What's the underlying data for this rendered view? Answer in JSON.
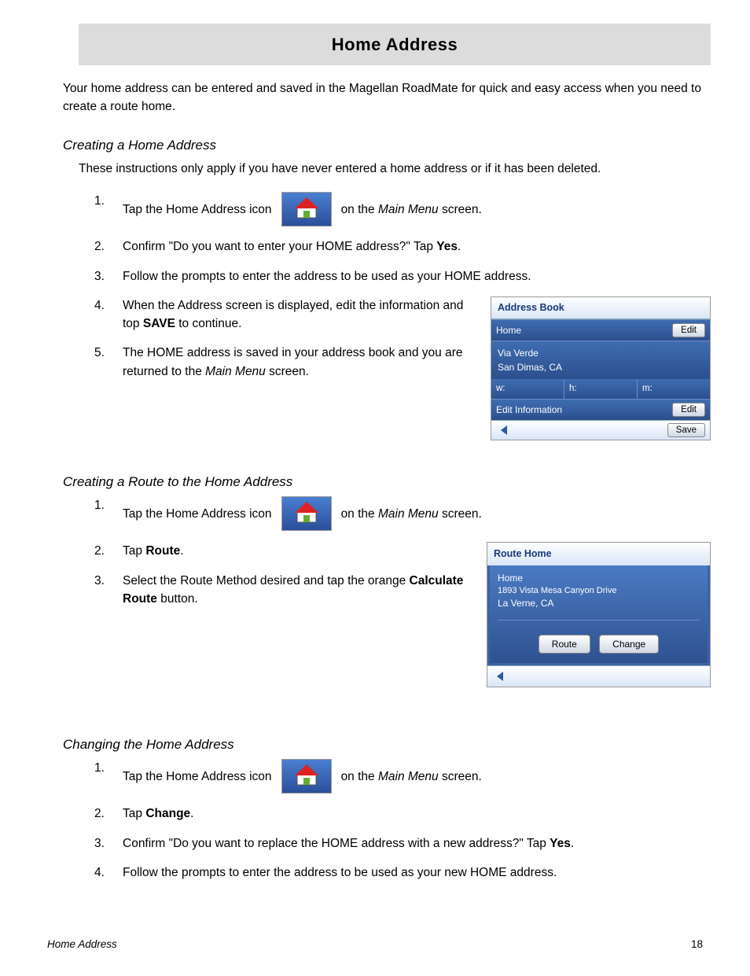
{
  "title": "Home Address",
  "intro": "Your home address can be entered and saved in the Magellan RoadMate for quick and easy access when you need to create a route home.",
  "footer": {
    "left": "Home Address",
    "right": "18"
  },
  "s1": {
    "heading": "Creating a Home Address",
    "sub": "These instructions only apply if you have never entered a home address or if it has been deleted.",
    "n1": "1.",
    "t1a": "Tap the Home Address icon",
    "t1b_pre": "on the ",
    "t1b_it": "Main Menu",
    "t1b_post": " screen.",
    "n2": "2.",
    "t2_pre": "Confirm \"Do you want to enter your HOME address?\"  Tap ",
    "t2_b": "Yes",
    "t2_post": ".",
    "n3": "3.",
    "t3": "Follow the prompts to enter the address to be used as your HOME address.",
    "n4": "4.",
    "t4_pre": "When the Address screen is displayed, edit the information and top ",
    "t4_b": "SAVE",
    "t4_post": " to continue.",
    "n5": "5.",
    "t5_pre": "The HOME address is saved in your address book and you are returned to the ",
    "t5_it": "Main Menu",
    "t5_post": " screen."
  },
  "abook": {
    "title": "Address Book",
    "home": "Home",
    "edit": "Edit",
    "addr1": "Via Verde",
    "addr2": "San Dimas, CA",
    "w": "w:",
    "h": "h:",
    "m": "m:",
    "editinfo": "Edit Information",
    "save": "Save"
  },
  "s2": {
    "heading": "Creating a Route to the Home Address",
    "n1": "1.",
    "t1a": "Tap the Home Address icon",
    "t1b_pre": "on the ",
    "t1b_it": "Main Menu",
    "t1b_post": " screen.",
    "n2": "2.",
    "t2_pre": "Tap ",
    "t2_b": "Route",
    "t2_post": ".",
    "n3": "3.",
    "t3_pre": "Select the Route Method desired and tap the orange ",
    "t3_b": "Calculate Route",
    "t3_post": " button."
  },
  "rhome": {
    "title": "Route Home",
    "name": "Home",
    "addr1": "1893 Vista Mesa Canyon Drive",
    "addr2": "La Verne, CA",
    "route": "Route",
    "change": "Change"
  },
  "s3": {
    "heading": "Changing the Home Address",
    "n1": "1.",
    "t1a": "Tap the Home Address icon",
    "t1b_pre": "on the ",
    "t1b_it": "Main Menu",
    "t1b_post": " screen.",
    "n2": "2.",
    "t2_pre": "Tap ",
    "t2_b": "Change",
    "t2_post": ".",
    "n3": "3.",
    "t3_pre": "Confirm \"Do you want to replace the HOME address with a new address?\"  Tap ",
    "t3_b": "Yes",
    "t3_post": ".",
    "n4": "4.",
    "t4": "Follow the prompts to enter the address to be used as your new HOME address."
  }
}
